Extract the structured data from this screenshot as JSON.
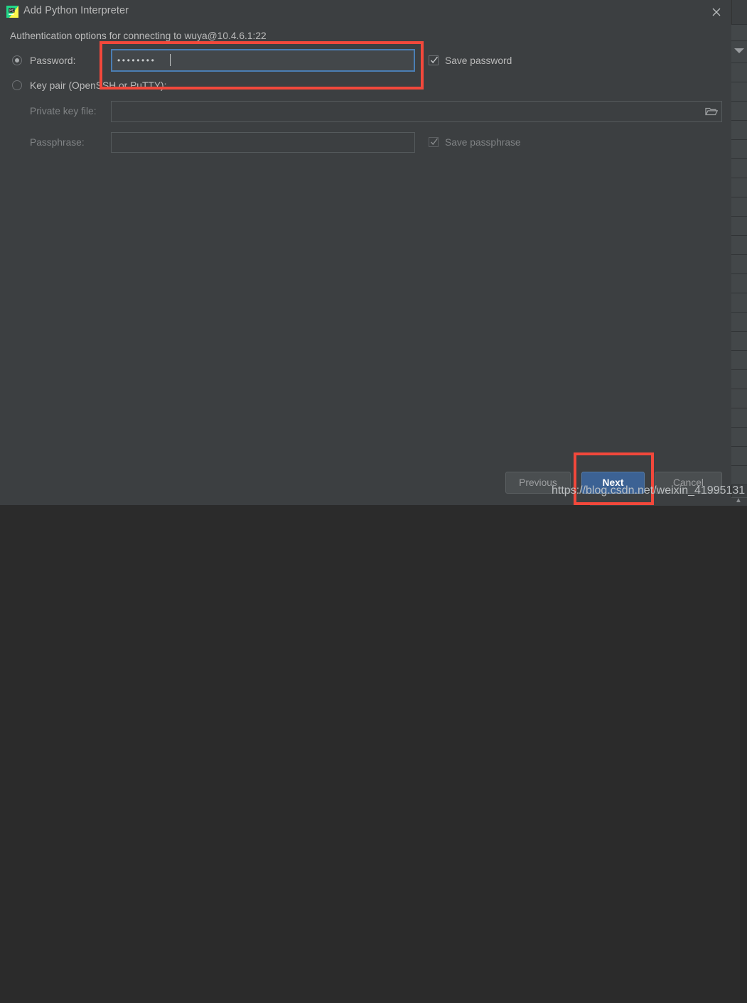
{
  "window": {
    "title": "Add Python Interpreter",
    "icon": "pycharm-logo-icon",
    "close_icon": "close-icon"
  },
  "content": {
    "subtitle": "Authentication options for connecting to wuya@10.4.6.1:22",
    "auth_options": [
      {
        "id": "password",
        "label": "Password:",
        "selected": true
      },
      {
        "id": "key-pair",
        "label": "Key pair (OpenSSH or PuTTY):",
        "selected": false
      }
    ],
    "password_field": {
      "value": "••••••••",
      "placeholder": "",
      "focused": true
    },
    "save_password": {
      "label": "Save password",
      "checked": true,
      "enabled": true
    },
    "private_key_file": {
      "label": "Private key file:",
      "value": "",
      "placeholder": "",
      "browse_icon": "folder-icon"
    },
    "passphrase": {
      "label": "Passphrase:",
      "value": "",
      "placeholder": ""
    },
    "save_passphrase": {
      "label": "Save passphrase",
      "checked": true,
      "enabled": false
    }
  },
  "footer": {
    "buttons": [
      {
        "id": "previous",
        "label": "Previous",
        "primary": false
      },
      {
        "id": "next",
        "label": "Next",
        "primary": true
      },
      {
        "id": "cancel",
        "label": "Cancel",
        "primary": false
      }
    ]
  },
  "annotations": {
    "color": "#f2483b",
    "boxes": [
      "password-field-highlight",
      "next-button-highlight"
    ]
  },
  "watermark": {
    "text": "https://blog.csdn.net/weixin_41995131"
  },
  "background": {
    "dropdown_icon": "chevron-down-icon",
    "warning_icon": "warning-icon"
  },
  "colors": {
    "dialog_bg": "#3c3f41",
    "text": "#bbbbbb",
    "accent_blue": "#3c6294",
    "focus_blue": "#4b7eb4",
    "annotation_red": "#f2483b"
  }
}
